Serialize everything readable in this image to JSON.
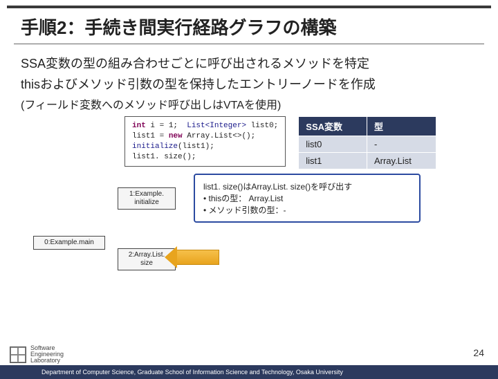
{
  "title": "手順2：手続き間実行経路グラフの構築",
  "body": {
    "line1": "SSA変数の型の組み合わせごとに呼び出されるメソッドを特定",
    "line2": "thisおよびメソッド引数の型を保持したエントリーノードを作成",
    "line3": "(フィールド変数へのメソッド呼び出しはVTAを使用)"
  },
  "code": {
    "l1a": "int",
    "l1b": " i = 1;  ",
    "l1c": "List<Integer>",
    "l1d": " list0;",
    "l2a": "list1 = ",
    "l2b": "new",
    "l2c": " Array.List<>();",
    "l3a": "initialize",
    "l3b": "(list1);",
    "l4": "list1. size();"
  },
  "table": {
    "head": {
      "c1": "SSA変数",
      "c2": "型"
    },
    "rows": [
      {
        "c1": "list0",
        "c2": "-"
      },
      {
        "c1": "list1",
        "c2": "Array.List"
      }
    ]
  },
  "nodes": {
    "n1": "1:Example.\ninitialize",
    "n0": "0:Example.main",
    "n2": "2:Array.List.\nsize"
  },
  "callout": {
    "l1": "list1. size()はArray.List. size()を呼び出す",
    "l2": "•  thisの型： Array.List",
    "l3": "•  メソッド引数の型：-"
  },
  "page_number": "24",
  "footer": "Department of Computer Science, Graduate School of Information Science and Technology, Osaka University",
  "logo_text": "Software\nEngineering\nLaboratory"
}
